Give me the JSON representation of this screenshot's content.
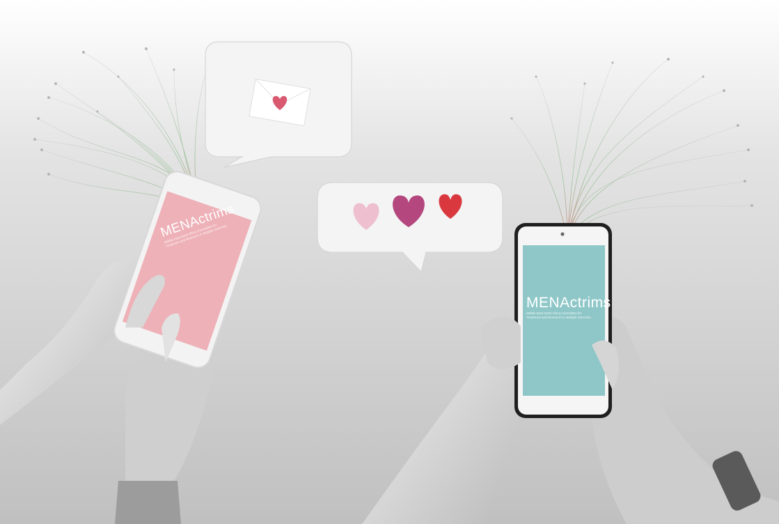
{
  "left_phone": {
    "logo_text": "MENActrims",
    "tagline_line1": "Middle East North Africa Committee for",
    "tagline_line2": "Treatment and Research in Multiple Sclerosis",
    "screen_color": "#eeb1b8"
  },
  "right_phone": {
    "logo_text": "MENActrims",
    "tagline_line1": "Middle East North Africa Committee for",
    "tagline_line2": "Treatment and Research in Multiple Sclerosis",
    "screen_color": "#8fc7c8"
  },
  "bubbles": {
    "envelope_bubble_icon": "envelope-heart-icon",
    "hearts_bubble_icons": [
      "heart-light-pink-icon",
      "heart-magenta-icon",
      "heart-red-icon"
    ]
  },
  "colors": {
    "heart_light": "#eec0cf",
    "heart_magenta": "#b4477e",
    "heart_red": "#d9383f",
    "envelope_heart": "#d95a70"
  }
}
